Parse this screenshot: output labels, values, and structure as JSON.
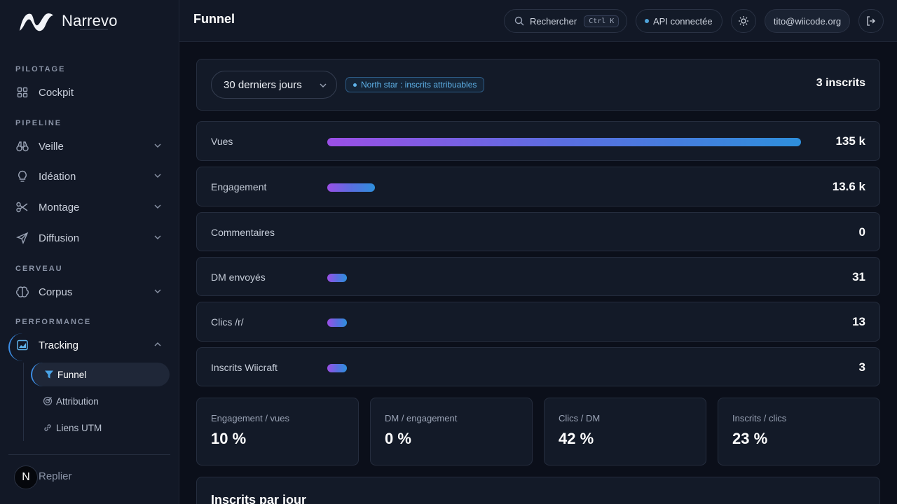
{
  "brand": {
    "name": "Narrevo"
  },
  "sidebar": {
    "sections": [
      {
        "label": "PILOTAGE"
      },
      {
        "label": "PIPELINE"
      },
      {
        "label": "CERVEAU"
      },
      {
        "label": "PERFORMANCE"
      }
    ],
    "items": {
      "cockpit": "Cockpit",
      "veille": "Veille",
      "ideation": "Idéation",
      "montage": "Montage",
      "diffusion": "Diffusion",
      "corpus": "Corpus",
      "tracking": "Tracking"
    },
    "subitems": {
      "funnel": "Funnel",
      "attribution": "Attribution",
      "liens_utm": "Liens UTM"
    },
    "avatar_initial": "N",
    "collapse_label": "Replier"
  },
  "header": {
    "title": "Funnel",
    "search_label": "Rechercher",
    "search_shortcut": "Ctrl K",
    "api_status": "API connectée",
    "user_email": "tito@wiicode.org"
  },
  "filters": {
    "period": "30 derniers jours",
    "north_star": "North star : inscrits attribuables",
    "total": "3 inscrits"
  },
  "funnel": [
    {
      "label": "Vues",
      "value": "135 k",
      "fill": 1.0
    },
    {
      "label": "Engagement",
      "value": "13.6 k",
      "fill": 0.1
    },
    {
      "label": "Commentaires",
      "value": "0",
      "fill": 0
    },
    {
      "label": "DM envoyés",
      "value": "31",
      "fill": 0.0002
    },
    {
      "label": "Clics /r/",
      "value": "13",
      "fill": 0.0001
    },
    {
      "label": "Inscrits Wiicraft",
      "value": "3",
      "fill": 2e-05
    }
  ],
  "kpis": [
    {
      "label": "Engagement / vues",
      "value": "10 %"
    },
    {
      "label": "DM / engagement",
      "value": "0 %"
    },
    {
      "label": "Clics / DM",
      "value": "42 %"
    },
    {
      "label": "Inscrits / clics",
      "value": "23 %"
    }
  ],
  "chart_section": {
    "title": "Inscrits par jour"
  },
  "colors": {
    "accent": "#3c8ee6",
    "bar_start": "#9b4fe6",
    "bar_end": "#2e8fdc",
    "background": "#0b0f1a",
    "panel": "#131a28"
  }
}
